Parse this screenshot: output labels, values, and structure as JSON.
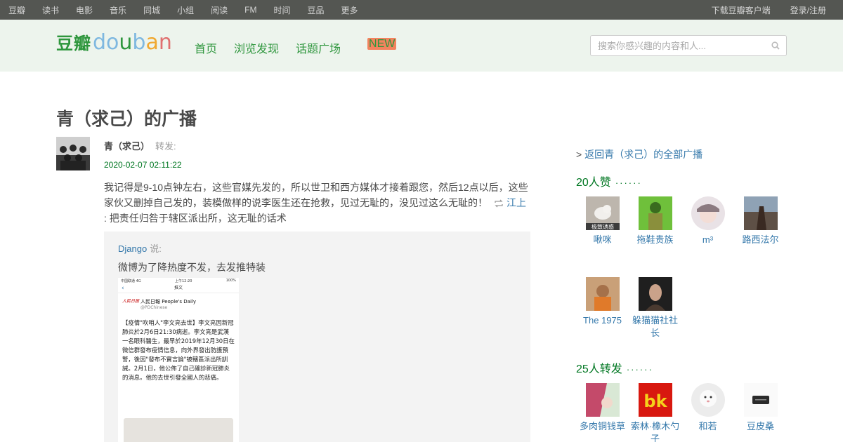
{
  "global_nav": {
    "left": [
      "豆瓣",
      "读书",
      "电影",
      "音乐",
      "同城",
      "小组",
      "阅读",
      "FM",
      "时间",
      "豆品",
      "更多"
    ],
    "right": [
      "下载豆瓣客户端",
      "登录/注册"
    ]
  },
  "header": {
    "logo_cn": "豆瓣",
    "logo_en": "douban",
    "nav": [
      "首页",
      "浏览发现",
      "话题广场"
    ],
    "new_tag": "NEW",
    "search_placeholder": "搜索你感兴趣的内容和人..."
  },
  "main": {
    "page_title": "青（求己）的广播",
    "status": {
      "author": "青（求己）",
      "action": "转发:",
      "time": "2020-02-07 02:11:22",
      "text": "我记得是9-10点钟左右，这些官媒先发的，所以世卫和西方媒体才接着跟您，然后12点以后，这些家伙又删掉自己发的，装模做样的说李医生还在抢救，见过无耻的，没见过这么无耻的！",
      "reshare_user": "江上",
      "text_after": ": 把责任归咎于辖区派出所，这无耻的话术"
    },
    "quote": {
      "user": "Django",
      "said": "说:",
      "text": "微博为了降热度不发，去发推特装",
      "phone": {
        "status_left": "中国联通 4G",
        "status_time": "上午12:20",
        "status_right": "100%",
        "nav_title": "推文",
        "logo_text": "人民日报",
        "tweet_name": "人民日報 People's Daily",
        "tweet_handle": "@PDChinese",
        "tweet_body": "【疫情\"吹哨人\"李文亮去世】李文亮因新冠肺炎於2月6日21:30病逝。李文亮是武漢一名眼科醫生，最早於2019年12月30日在微信群發布疫情信息，向外界發出防護預警，後因\"發布不實言論\"被轄區派出所訓誡。2月1日，他公佈了自己確診新冠肺炎的消息。他的去世引發全國人的悲痛。"
      }
    }
  },
  "sidebar": {
    "back_link": "返回青（求己）的全部广播",
    "likes_title": "20人赞",
    "likes_dots": "······",
    "likes_users": [
      "啾咪",
      "拖鞋贵族",
      "m³",
      "路西法尔",
      "The 1975",
      "躲猫猫社社长"
    ],
    "likes_avatar_caption": "极致诱惑",
    "reshares_title": "25人转发",
    "reshares_dots": "······",
    "reshares_users": [
      "多肉铜钱草",
      "索林·橡木勺子",
      "和若",
      "豆皮桑"
    ],
    "reshare_logo_text": "bk"
  },
  "colors": {
    "topbar": "#545652",
    "header_bg": "#edf4ed",
    "green": "#007722",
    "link": "#3377aa"
  }
}
